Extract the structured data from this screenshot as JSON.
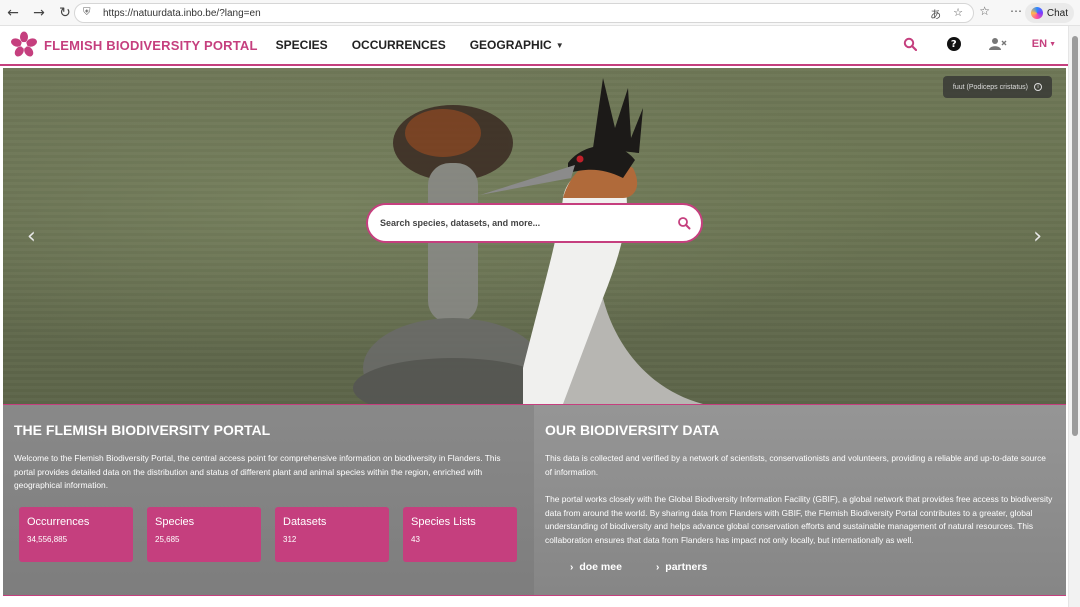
{
  "browser": {
    "url": "https://natuurdata.inbo.be/?lang=en",
    "chat_label": "Chat"
  },
  "header": {
    "brand": "FLEMISH BIODIVERSITY PORTAL",
    "menu": [
      {
        "label": "SPECIES"
      },
      {
        "label": "OCCURRENCES"
      },
      {
        "label": "GEOGRAPHIC"
      }
    ],
    "language": "EN"
  },
  "hero": {
    "photo_credit": "fuut (Podiceps cristatus)",
    "search_placeholder": "Search species, datasets, and more..."
  },
  "left_panel": {
    "title": "THE FLEMISH BIODIVERSITY PORTAL",
    "text": "Welcome to the Flemish Biodiversity Portal, the central access point for comprehensive information on biodiversity in Flanders. This portal provides detailed data on the distribution and status of different plant and animal species within the region, enriched with geographical information.",
    "stats": [
      {
        "label": "Occurrences",
        "value": "34,556,885"
      },
      {
        "label": "Species",
        "value": "25,685"
      },
      {
        "label": "Datasets",
        "value": "312"
      },
      {
        "label": "Species Lists",
        "value": "43"
      }
    ]
  },
  "right_panel": {
    "title": "OUR BIODIVERSITY DATA",
    "text1": "This data is collected and verified by a network of scientists, conservationists and volunteers, providing a reliable and up-to-date source of information.",
    "text2": "The portal works closely with the Global Biodiversity Information Facility (GBIF), a global network that provides free access to biodiversity data from around the world. By sharing data from Flanders with GBIF, the Flemish Biodiversity Portal contributes to a greater, global understanding of biodiversity and helps advance global conservation efforts and sustainable management of natural resources. This collaboration ensures that data from Flanders has impact not only locally, but internationally as well.",
    "links": [
      {
        "label": "doe mee"
      },
      {
        "label": "partners"
      }
    ]
  },
  "colors": {
    "accent": "#c53f7e"
  }
}
